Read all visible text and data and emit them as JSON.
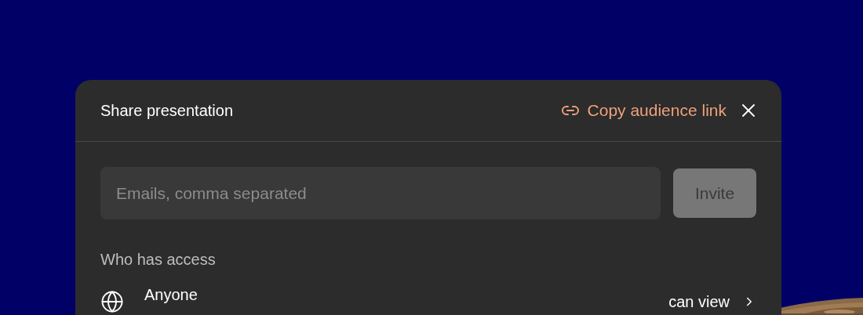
{
  "dialog": {
    "title": "Share presentation",
    "copy_link": "Copy audience link",
    "invite": {
      "placeholder": "Emails, comma separated",
      "button": "Invite",
      "disabled": true
    },
    "access": {
      "heading": "Who has access",
      "entries": [
        {
          "name": "Anyone",
          "permission": "can view"
        }
      ]
    }
  }
}
